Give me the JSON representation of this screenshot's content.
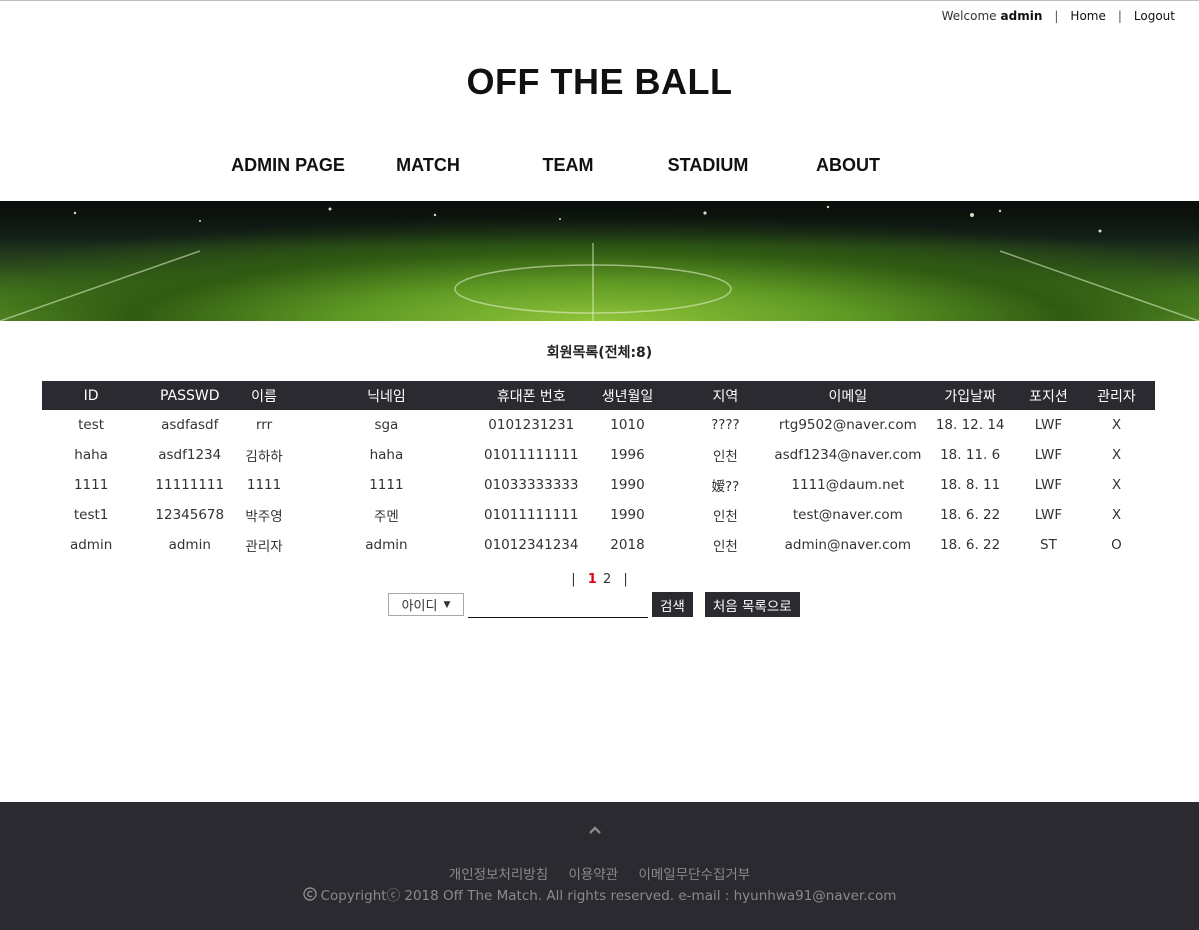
{
  "topbar": {
    "welcome": "Welcome",
    "user": "admin",
    "home": "Home",
    "logout": "Logout",
    "sep": "|"
  },
  "site": {
    "title": "OFF THE BALL"
  },
  "nav": {
    "items": [
      "ADMIN PAGE",
      "MATCH",
      "TEAM",
      "STADIUM",
      "ABOUT"
    ]
  },
  "list": {
    "title": "회원목록(전체:8)"
  },
  "table": {
    "headers": [
      "ID",
      "PASSWD",
      "이름",
      "닉네임",
      "휴대폰 번호",
      "생년월일",
      "지역",
      "이메일",
      "가입날짜",
      "포지션",
      "관리자"
    ],
    "rows": [
      [
        "test",
        "asdfasdf",
        "rrr",
        "sga",
        "0101231231",
        "1010",
        "????",
        "rtg9502@naver.com",
        "18. 12. 14",
        "LWF",
        "X"
      ],
      [
        "haha",
        "asdf1234",
        "김하하",
        "haha",
        "01011111111",
        "1996",
        "인천",
        "asdf1234@naver.com",
        "18. 11. 6",
        "LWF",
        "X"
      ],
      [
        "1111",
        "11111111",
        "1111",
        "1111",
        "01033333333",
        "1990",
        "嫒??",
        "1111@daum.net",
        "18. 8. 11",
        "LWF",
        "X"
      ],
      [
        "test1",
        "12345678",
        "박주영",
        "주멘",
        "01011111111",
        "1990",
        "인천",
        "test@naver.com",
        "18. 6. 22",
        "LWF",
        "X"
      ],
      [
        "admin",
        "admin",
        "관리자",
        "admin",
        "01012341234",
        "2018",
        "인천",
        "admin@naver.com",
        "18. 6. 22",
        "ST",
        "O"
      ]
    ]
  },
  "pager": {
    "sep": "|",
    "current": "1",
    "next": "2"
  },
  "search": {
    "field_selected": "아이디",
    "arrow": "▼",
    "value": "",
    "search_label": "검색",
    "reset_label": "처음 목록으로"
  },
  "footer": {
    "links": [
      "개인정보처리방침",
      "이용약관",
      "이메일무단수집거부"
    ],
    "copyright": "Copyrightⓒ 2018 Off The Match. All rights reserved. e-mail : hyunhwa91@naver.com"
  },
  "colors": {
    "dark": "#2b2a30",
    "accent_red": "#e0001a",
    "footer_text": "#8a8a8a"
  }
}
